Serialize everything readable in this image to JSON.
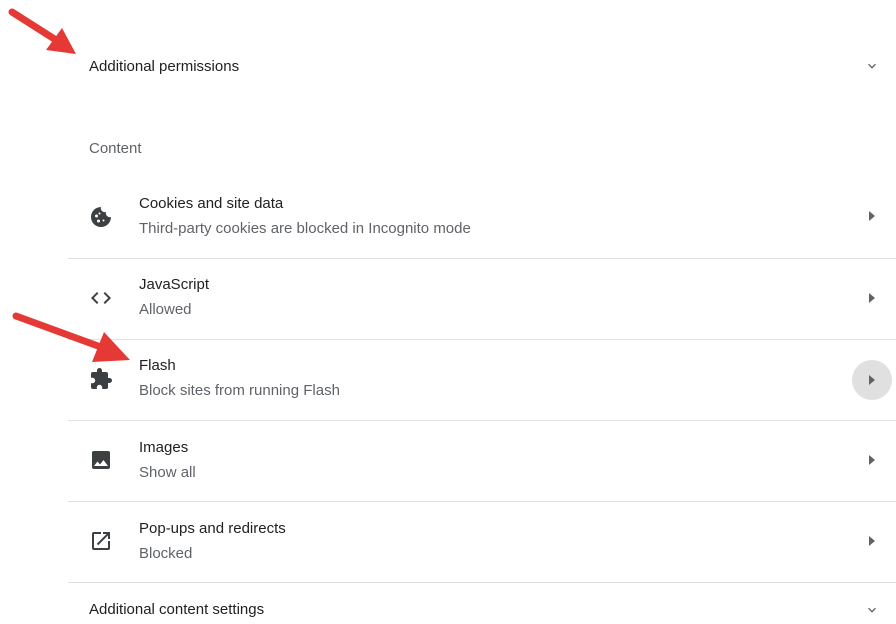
{
  "additional_permissions": {
    "label": "Additional permissions",
    "icon": "chevron-down-icon"
  },
  "content_section": {
    "heading": "Content",
    "items": [
      {
        "title": "Cookies and site data",
        "subtitle": "Third-party cookies are blocked in Incognito mode",
        "icon": "cookie-icon"
      },
      {
        "title": "JavaScript",
        "subtitle": "Allowed",
        "icon": "code-icon"
      },
      {
        "title": "Flash",
        "subtitle": "Block sites from running Flash",
        "icon": "puzzle-icon"
      },
      {
        "title": "Images",
        "subtitle": "Show all",
        "icon": "image-icon"
      },
      {
        "title": "Pop-ups and redirects",
        "subtitle": "Blocked",
        "icon": "open-in-new-icon"
      }
    ]
  },
  "additional_content_settings": {
    "label": "Additional content settings",
    "icon": "chevron-down-icon"
  },
  "colors": {
    "annotation_arrow": "#e53935",
    "hover_circle": "#e0e0e0",
    "divider": "#e0e0e0",
    "secondary_text": "#5f6368"
  }
}
